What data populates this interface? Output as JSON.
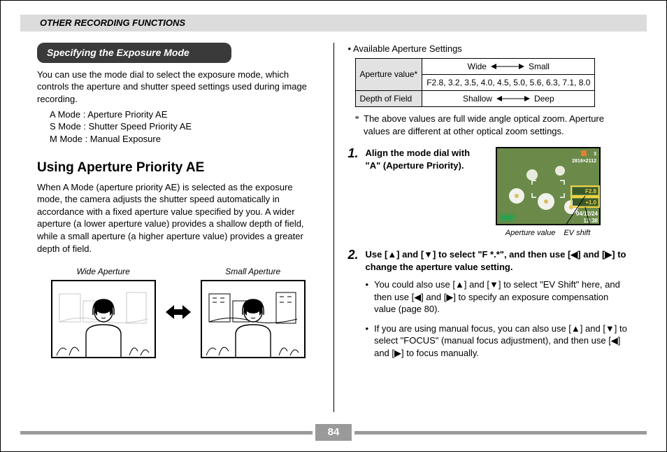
{
  "header": {
    "section_title": "OTHER RECORDING FUNCTIONS"
  },
  "left": {
    "section_heading": "Specifying the Exposure Mode",
    "intro": "You can use the mode dial to select the exposure mode, which controls the aperture and shutter speed settings used during image recording.",
    "modes": [
      "A Mode : Aperture Priority AE",
      "S Mode : Shutter Speed Priority AE",
      "M Mode : Manual Exposure"
    ],
    "h2": "Using Aperture Priority AE",
    "h2_body": "When A Mode (aperture priority AE) is selected as the exposure mode, the camera adjusts the shutter speed automatically in accordance with a fixed aperture value specified by you. A wider aperture (a lower aperture value) provides a shallow depth of field, while a small aperture (a higher aperture value) provides a greater depth of field.",
    "panel_labels": {
      "wide": "Wide Aperture",
      "small": "Small Aperture"
    }
  },
  "right": {
    "avail_heading": "• Available Aperture Settings",
    "table": {
      "row1_label": "Aperture value*",
      "row1_top": {
        "left": "Wide",
        "right": "Small"
      },
      "row1_values": "F2.8, 3.2, 3.5, 4.0, 4.5, 5.0, 5.6, 6.3, 7.1, 8.0",
      "row2_label": "Depth of Field",
      "row2_top": {
        "left": "Shallow",
        "right": "Deep"
      }
    },
    "note_marker": "*",
    "note_text": "The above values are full wide angle optical zoom. Aperture values are different at other optical zoom settings.",
    "steps": [
      {
        "num": "1",
        "text": "Align the mode dial with \"A\" (Aperture Priority).",
        "lcd_caption_left": "Aperture value",
        "lcd_caption_right": "EV shift"
      },
      {
        "num": "2",
        "text": "Use [▲] and [▼] to select \"F *.*\", and then use [◀] and [▶] to change the aperture value setting.",
        "bullets": [
          "You could also use [▲] and [▼] to select \"EV Shift\" here, and then use [◀] and [▶] to specify an exposure compensation value (page 80).",
          "If you are using manual focus, you can also use [▲] and [▼] to select \"FOCUS\" (manual focus adjustment), and then use [◀] and [▶] to focus manually."
        ]
      }
    ],
    "lcd_overlay": {
      "resolution": "2816×2112",
      "count": "3",
      "aperture": "F2.8",
      "ev": "+1.0",
      "date": "04/12/24",
      "time": "12:38"
    }
  },
  "footer": {
    "page": "84"
  }
}
